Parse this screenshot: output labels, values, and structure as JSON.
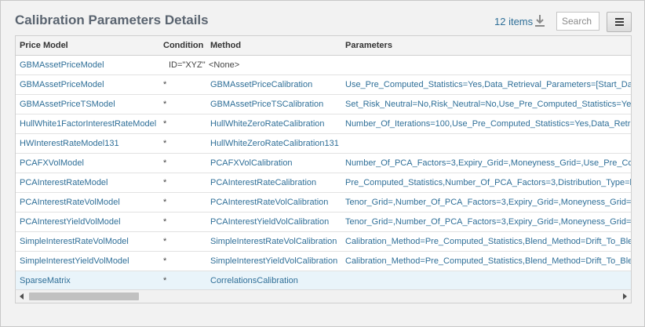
{
  "header": {
    "title": "Calibration Parameters Details",
    "items_count": "12 items",
    "search_placeholder": "Search"
  },
  "table": {
    "columns": [
      "Price Model",
      "Condition",
      "Method",
      "Parameters"
    ],
    "rows": [
      {
        "model": "GBMAssetPriceModel",
        "condition": "ID=\"XYZ\"",
        "method": "<None>",
        "parameters": ""
      },
      {
        "model": "GBMAssetPriceModel",
        "condition": "*",
        "method": "GBMAssetPriceCalibration",
        "parameters": "Use_Pre_Computed_Statistics=Yes,Data_Retrieval_Parameters=[Start_Da"
      },
      {
        "model": "GBMAssetPriceTSModel",
        "condition": "*",
        "method": "GBMAssetPriceTSCalibration",
        "parameters": "Set_Risk_Neutral=No,Risk_Neutral=No,Use_Pre_Computed_Statistics=Ye"
      },
      {
        "model": "HullWhite1FactorInterestRateModel",
        "condition": "*",
        "method": "HullWhiteZeroRateCalibration",
        "parameters": "Number_Of_Iterations=100,Use_Pre_Computed_Statistics=Yes,Data_Retri"
      },
      {
        "model": "HWInterestRateModel131",
        "condition": "*",
        "method": "HullWhiteZeroRateCalibration131",
        "parameters": ""
      },
      {
        "model": "PCAFXVolModel",
        "condition": "*",
        "method": "PCAFXVolCalibration",
        "parameters": "Number_Of_PCA_Factors=3,Expiry_Grid=,Moneyness_Grid=,Use_Pre_Co"
      },
      {
        "model": "PCAInterestRateModel",
        "condition": "*",
        "method": "PCAInterestRateCalibration",
        "parameters": "Pre_Computed_Statistics,Number_Of_PCA_Factors=3,Distribution_Type=l"
      },
      {
        "model": "PCAInterestRateVolModel",
        "condition": "*",
        "method": "PCAInterestRateVolCalibration",
        "parameters": "Tenor_Grid=,Number_Of_PCA_Factors=3,Expiry_Grid=,Moneyness_Grid="
      },
      {
        "model": "PCAInterestYieldVolModel",
        "condition": "*",
        "method": "PCAInterestYieldVolCalibration",
        "parameters": "Tenor_Grid=,Number_Of_PCA_Factors=3,Expiry_Grid=,Moneyness_Grid="
      },
      {
        "model": "SimpleInterestRateVolModel",
        "condition": "*",
        "method": "SimpleInterestRateVolCalibration",
        "parameters": "Calibration_Method=Pre_Computed_Statistics,Blend_Method=Drift_To_Ble"
      },
      {
        "model": "SimpleInterestYieldVolModel",
        "condition": "*",
        "method": "SimpleInterestYieldVolCalibration",
        "parameters": "Calibration_Method=Pre_Computed_Statistics,Blend_Method=Drift_To_Ble"
      },
      {
        "model": "SparseMatrix",
        "condition": "*",
        "method": "CorrelationsCalibration",
        "parameters": ""
      }
    ]
  },
  "icons": {
    "download": "download-icon",
    "menu": "hamburger-menu-icon",
    "scroll_left": "arrow-left-icon",
    "scroll_right": "arrow-right-icon"
  },
  "colors": {
    "link": "#2f6f98",
    "title": "#5a6470",
    "selected_row": "#e9f4fa"
  }
}
